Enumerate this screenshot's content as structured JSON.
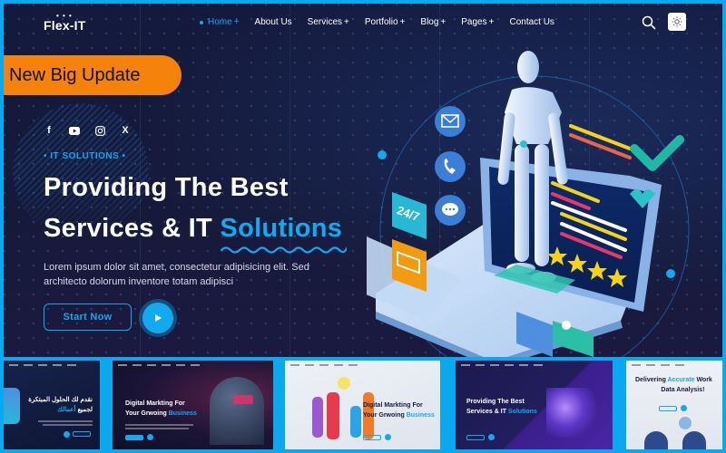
{
  "header": {
    "logo": "Flex-IT",
    "nav": [
      {
        "label": "Home",
        "suffix": "+",
        "active": true
      },
      {
        "label": "About Us",
        "suffix": "",
        "active": false
      },
      {
        "label": "Services",
        "suffix": "+",
        "active": false
      },
      {
        "label": "Portfolio",
        "suffix": "+",
        "active": false
      },
      {
        "label": "Blog",
        "suffix": "+",
        "active": false
      },
      {
        "label": "Pages",
        "suffix": "+",
        "active": false
      },
      {
        "label": "Contact Us",
        "suffix": "",
        "active": false
      }
    ],
    "icons": {
      "search": "search-icon",
      "theme": "sun-icon"
    }
  },
  "badge": {
    "label": "New Big Update"
  },
  "social": [
    {
      "name": "facebook-icon",
      "glyph": "f"
    },
    {
      "name": "youtube-icon",
      "glyph": "▶"
    },
    {
      "name": "instagram-icon",
      "glyph": "◎"
    },
    {
      "name": "x-icon",
      "glyph": "X"
    }
  ],
  "hero": {
    "tagline": "• IT SOLUTIONS •",
    "title_line1": "Providing The Best",
    "title_line2_prefix": "Services & IT ",
    "title_line2_accent": "Solutions",
    "description": "Lorem ipsum dolor sit amet, consectetur adipisicing elit. Sed architecto dolorum inventore totam adipisci",
    "cta_label": "Start Now",
    "illustration_badge": "24/7"
  },
  "thumbnails": [
    {
      "name": "thumb-rtl",
      "title1": "نقدم لك الحلول المبتكرة",
      "title2_prefix": "لجميع ",
      "title2_accent": "أعمالك",
      "theme": "dark"
    },
    {
      "name": "thumb-digital-marketing-dark",
      "title1": "Digital Markting For",
      "title2_prefix": "Your Grwoing ",
      "title2_accent": "Business",
      "theme": "dark-neon"
    },
    {
      "name": "thumb-digital-marketing-light",
      "title1": "Digital Markting For",
      "title2_prefix": "Your Grwoing ",
      "title2_accent": "Business",
      "theme": "light"
    },
    {
      "name": "thumb-it-solutions-purple",
      "title1": "Providing The Best",
      "title2_prefix": "Services & IT ",
      "title2_accent": "Solutions",
      "theme": "purple"
    },
    {
      "name": "thumb-data-analysis",
      "title1_prefix": "Delivering ",
      "title1_accent": "Accurate",
      "title1_suffix": " Work",
      "title2": "Data Analysis!",
      "theme": "light-gray"
    }
  ],
  "colors": {
    "accent": "#13a9f0",
    "frame": "#0aa8ef",
    "badge": "#f5820b",
    "background": "#151a3c"
  }
}
